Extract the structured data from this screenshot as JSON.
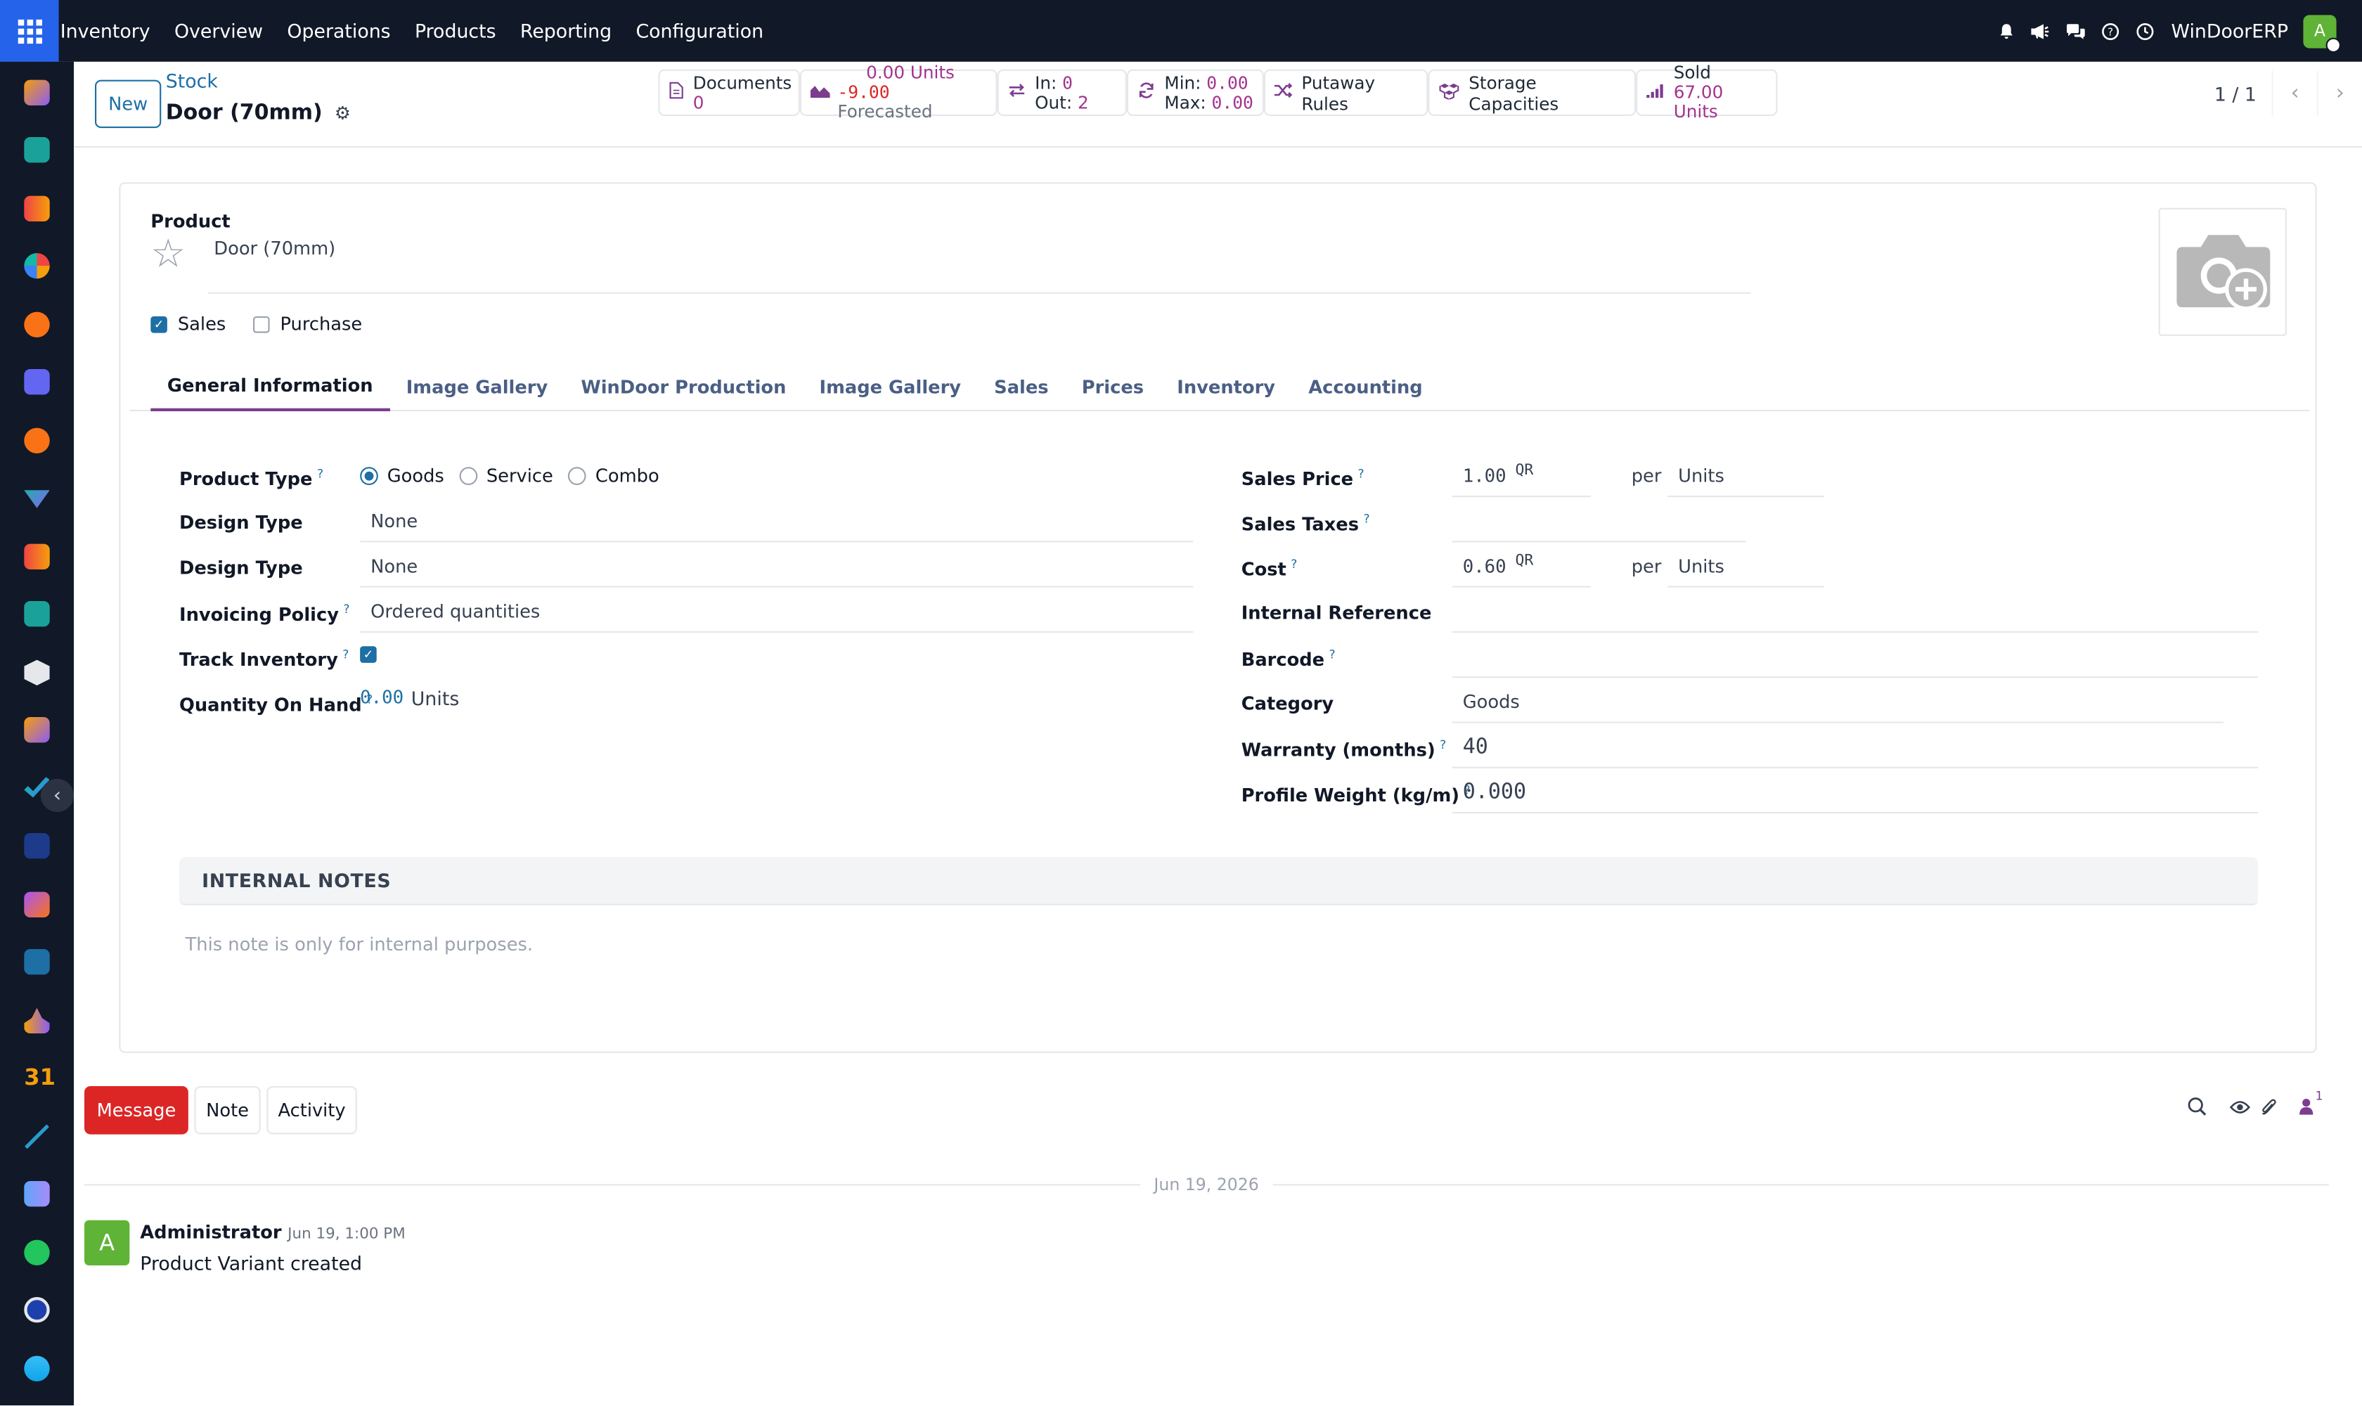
{
  "topnav": {
    "app": "Inventory",
    "menus": [
      "Overview",
      "Operations",
      "Products",
      "Reporting",
      "Configuration"
    ],
    "company": "WinDoorERP",
    "user_initial": "A"
  },
  "control": {
    "new_label": "New",
    "breadcrumb": "Stock",
    "record_title": "Door (70mm)",
    "pager": "1 / 1"
  },
  "smart_buttons": {
    "documents": {
      "label": "Documents",
      "value": "0"
    },
    "forecast": {
      "on_hand": "0.00 Units",
      "forecast_value": "-9.00",
      "forecast_label": "Forecasted"
    },
    "moves": {
      "in_label": "In:",
      "in_value": "0",
      "out_label": "Out:",
      "out_value": "2"
    },
    "minmax": {
      "min_label": "Min:",
      "min_value": "0.00",
      "max_label": "Max:",
      "max_value": "0.00"
    },
    "putaway": "Putaway Rules",
    "storage": "Storage Capacities",
    "sold": {
      "label": "Sold",
      "value": "67.00 Units"
    }
  },
  "form": {
    "product_label": "Product",
    "product_name": "Door (70mm)",
    "sales_label": "Sales",
    "purchase_label": "Purchase",
    "tabs": [
      "General Information",
      "Image Gallery",
      "WinDoor Production",
      "Image Gallery",
      "Sales",
      "Prices",
      "Inventory",
      "Accounting"
    ],
    "left": {
      "product_type_label": "Product Type",
      "product_type_options": [
        "Goods",
        "Service",
        "Combo"
      ],
      "design_type_label": "Design Type",
      "design_type_1": "None",
      "design_type_label_2": "Design Type",
      "design_type_2": "None",
      "invoicing_policy_label": "Invoicing Policy",
      "invoicing_policy": "Ordered quantities",
      "track_inventory_label": "Track Inventory",
      "qty_on_hand_label": "Quantity On Hand",
      "qty_on_hand_value": "0.00",
      "qty_on_hand_unit": "Units"
    },
    "right": {
      "sales_price_label": "Sales Price",
      "sales_price": "1.00",
      "currency": "QR",
      "per": "per",
      "unit": "Units",
      "sales_taxes_label": "Sales Taxes",
      "cost_label": "Cost",
      "cost": "0.60",
      "internal_ref_label": "Internal Reference",
      "barcode_label": "Barcode",
      "category_label": "Category",
      "category": "Goods",
      "warranty_label": "Warranty (months)",
      "warranty": "40",
      "profile_weight_label": "Profile Weight (kg/m)",
      "profile_weight": "0.000"
    },
    "notes_header": "INTERNAL NOTES",
    "notes_placeholder": "This note is only for internal purposes."
  },
  "chatter": {
    "message_btn": "Message",
    "note_btn": "Note",
    "activity_btn": "Activity",
    "follower_count": "1",
    "date_sep": "Jun 19, 2026",
    "author": "Administrator",
    "time": "Jun 19, 1:00 PM",
    "body": "Product Variant created",
    "author_initial": "A"
  },
  "colors": {
    "accent": "#7c3d8f",
    "link": "#1d6fa5",
    "danger": "#dc2626",
    "topbar": "#111827"
  }
}
